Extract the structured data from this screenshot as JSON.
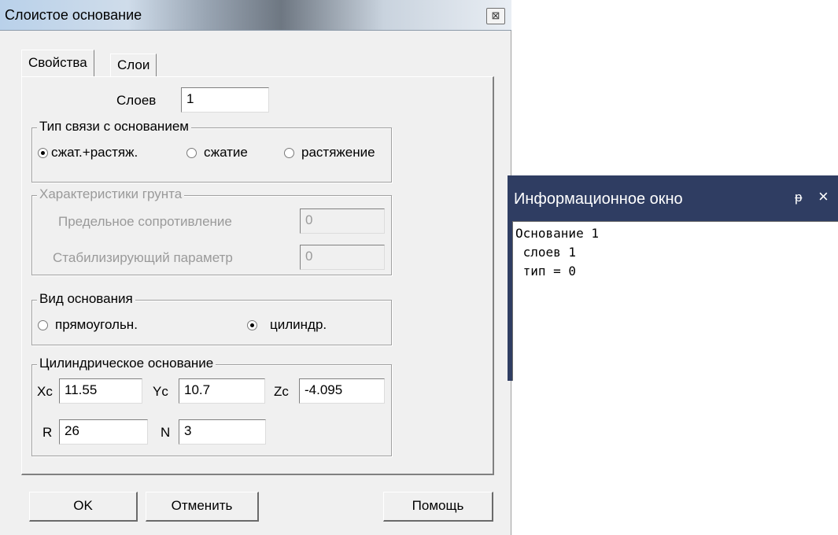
{
  "dialog": {
    "title": "Слоистое основание",
    "close_symbol": "⊠",
    "tabs": [
      "Свойства",
      "Слои"
    ],
    "layers_label": "Слоев",
    "layers_value": "1",
    "bond_group": {
      "title": "Тип связи с основанием",
      "options": [
        "сжат.+растяж.",
        "сжатие",
        "растяжение"
      ],
      "selected": 0
    },
    "soil_group": {
      "title": "Характеристики грунта",
      "limit_label": "Предельное сопротивление",
      "limit_value": "0",
      "stab_label": "Стабилизирующий параметр",
      "stab_value": "0"
    },
    "base_type_group": {
      "title": "Вид основания",
      "options": [
        "прямоугольн.",
        "цилиндр."
      ],
      "selected": 1
    },
    "cyl_group": {
      "title": "Цилиндрическое основание",
      "xc_label": "Xc",
      "xc_value": "11.55",
      "yc_label": "Yc",
      "yc_value": "10.7",
      "zc_label": "Zc",
      "zc_value": "-4.095",
      "r_label": "R",
      "r_value": "26",
      "n_label": "N",
      "n_value": "3"
    },
    "buttons": {
      "ok": "OK",
      "cancel": "Отменить",
      "help": "Помощь"
    }
  },
  "info_window": {
    "title": "Информационное окно",
    "pin_symbol": "ᵽ",
    "close_symbol": "×",
    "lines": [
      "Основание 1",
      " слоев 1",
      " тип = 0"
    ]
  }
}
